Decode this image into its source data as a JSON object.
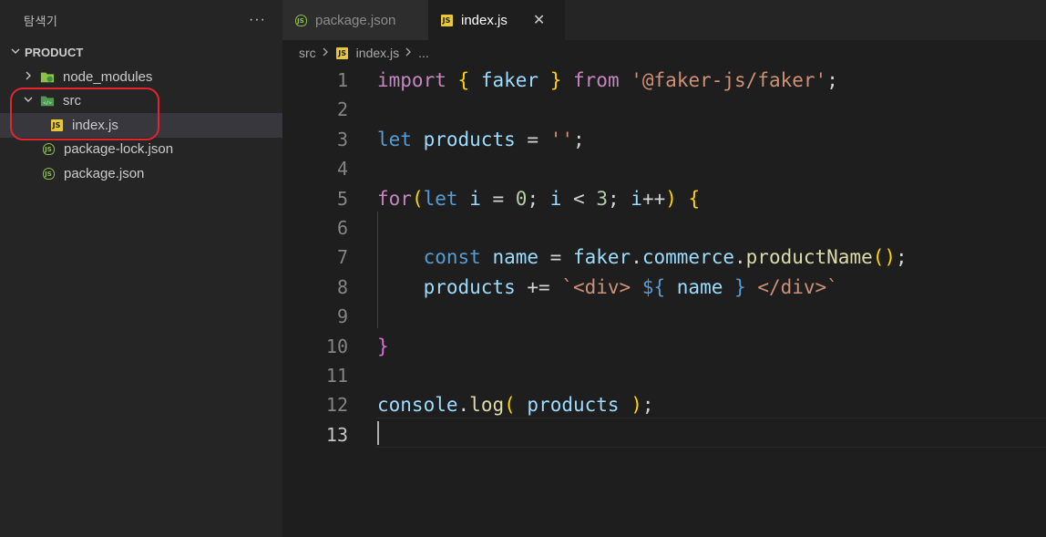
{
  "sidebar": {
    "title": "탐색기",
    "more": "···",
    "section": "PRODUCT",
    "items": [
      {
        "label": "node_modules"
      },
      {
        "label": "src"
      },
      {
        "label": "index.js"
      },
      {
        "label": "package-lock.json"
      },
      {
        "label": "package.json"
      }
    ]
  },
  "tabs": [
    {
      "label": "package.json"
    },
    {
      "label": "index.js",
      "close": "✕"
    }
  ],
  "breadcrumb": {
    "folder": "src",
    "file": "index.js",
    "more": "..."
  },
  "editor": {
    "line_numbers": [
      "1",
      "2",
      "3",
      "4",
      "5",
      "6",
      "7",
      "8",
      "9",
      "10",
      "11",
      "12",
      "13"
    ],
    "lines": [
      "import { faker } from '@faker-js/faker';",
      "",
      "let products = '';",
      "",
      "for(let i = 0; i < 3; i++) {",
      "",
      "    const name = faker.commerce.productName();",
      "    products += `<div> ${ name } </div>`",
      "",
      "}",
      "",
      "console.log( products );",
      ""
    ]
  },
  "colors": {
    "keyword": "#c586c0",
    "storage": "#569cd6",
    "variable": "#9cdcfe",
    "string": "#ce9178",
    "function": "#dcdcaa",
    "number": "#b5cea8",
    "annotation": "#e3262d"
  }
}
